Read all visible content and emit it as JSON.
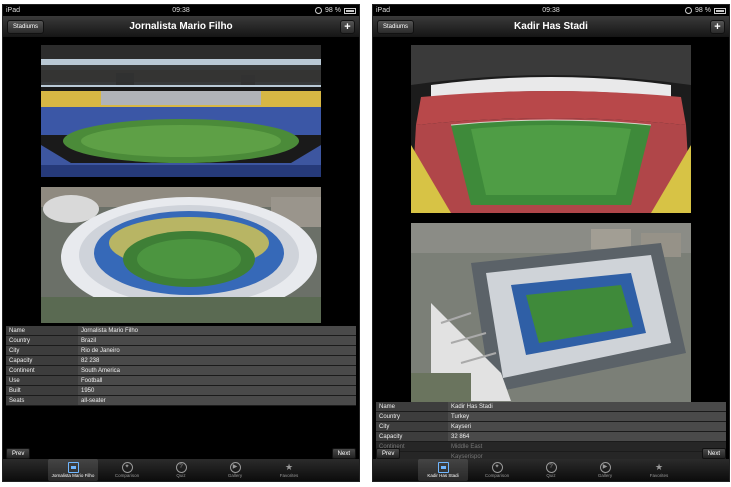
{
  "status_bar": {
    "carrier": "iPad",
    "time": "09:38",
    "battery": "98 %"
  },
  "tabs": [
    {
      "icon": "stadium-icon"
    },
    {
      "label": "Comparison",
      "icon": "compass-icon"
    },
    {
      "label": "Quiz",
      "icon": "question-icon"
    },
    {
      "label": "Gallery",
      "icon": "play-icon"
    },
    {
      "label": "Favorites",
      "icon": "star-icon"
    }
  ],
  "left": {
    "nav": {
      "back": "Stadiums",
      "title": "Jornalista Mario Filho",
      "add": "+"
    },
    "active_tab_label": "Jornalista Mario Filho",
    "pager": {
      "prev": "Prev",
      "next": "Next"
    },
    "info": [
      {
        "label": "Name",
        "value": "Jornalista Mario Filho"
      },
      {
        "label": "Country",
        "value": "Brazil"
      },
      {
        "label": "City",
        "value": "Rio de Janeiro"
      },
      {
        "label": "Capacity",
        "value": "82 238"
      },
      {
        "label": "Continent",
        "value": "South America"
      },
      {
        "label": "Use",
        "value": "Football"
      },
      {
        "label": "Built",
        "value": "1950"
      },
      {
        "label": "Seats",
        "value": "all-seater"
      }
    ]
  },
  "right": {
    "nav": {
      "back": "Stadiums",
      "title": "Kadir Has Stadi",
      "add": "+"
    },
    "active_tab_label": "Kadir Has Stadi",
    "pager": {
      "prev": "Prev",
      "next": "Next"
    },
    "info": [
      {
        "label": "Name",
        "value": "Kadir Has Stadi"
      },
      {
        "label": "Country",
        "value": "Turkey"
      },
      {
        "label": "City",
        "value": "Kayseri"
      },
      {
        "label": "Capacity",
        "value": "32 864"
      },
      {
        "label": "Continent",
        "value": "Middle East"
      },
      {
        "label": "",
        "value": "Kayserispor"
      }
    ]
  }
}
